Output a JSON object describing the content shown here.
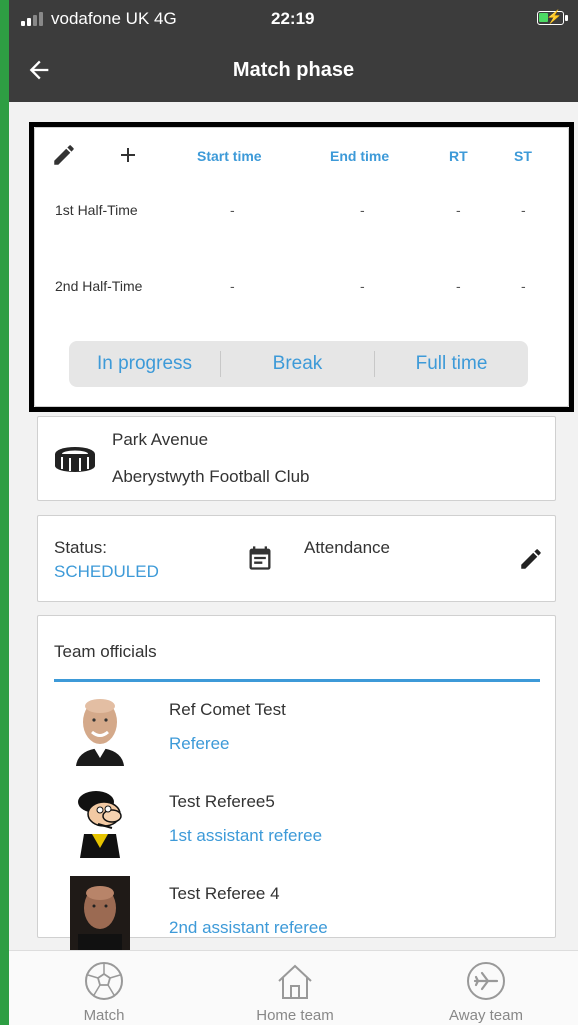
{
  "status_bar": {
    "carrier": "vodafone UK  4G",
    "time": "22:19"
  },
  "app_bar": {
    "title": "Match phase"
  },
  "phases": {
    "columns": [
      "Start time",
      "End time",
      "RT",
      "ST"
    ],
    "rows": [
      {
        "label": "1st Half-Time",
        "start": "-",
        "end": "-",
        "rt": "-",
        "st": "-"
      },
      {
        "label": "2nd Half-Time",
        "start": "-",
        "end": "-",
        "rt": "-",
        "st": "-"
      }
    ],
    "controls": [
      "In progress",
      "Break",
      "Full time"
    ]
  },
  "venue": {
    "name": "Park Avenue",
    "club": "Aberystwyth Football Club"
  },
  "status": {
    "label": "Status:",
    "value": "SCHEDULED",
    "attendance_label": "Attendance"
  },
  "officials": {
    "title": "Team officials",
    "items": [
      {
        "name": "Ref Comet Test",
        "role": "Referee"
      },
      {
        "name": "Test Referee5",
        "role": "1st assistant referee"
      },
      {
        "name": "Test Referee 4",
        "role": "2nd assistant referee"
      }
    ]
  },
  "nav": {
    "items": [
      {
        "label": "Match"
      },
      {
        "label": "Home team"
      },
      {
        "label": "Away team"
      }
    ]
  },
  "colors": {
    "accent": "#3d9ad8",
    "bar": "#3c3c3c",
    "page_edge": "#2e9e43"
  }
}
